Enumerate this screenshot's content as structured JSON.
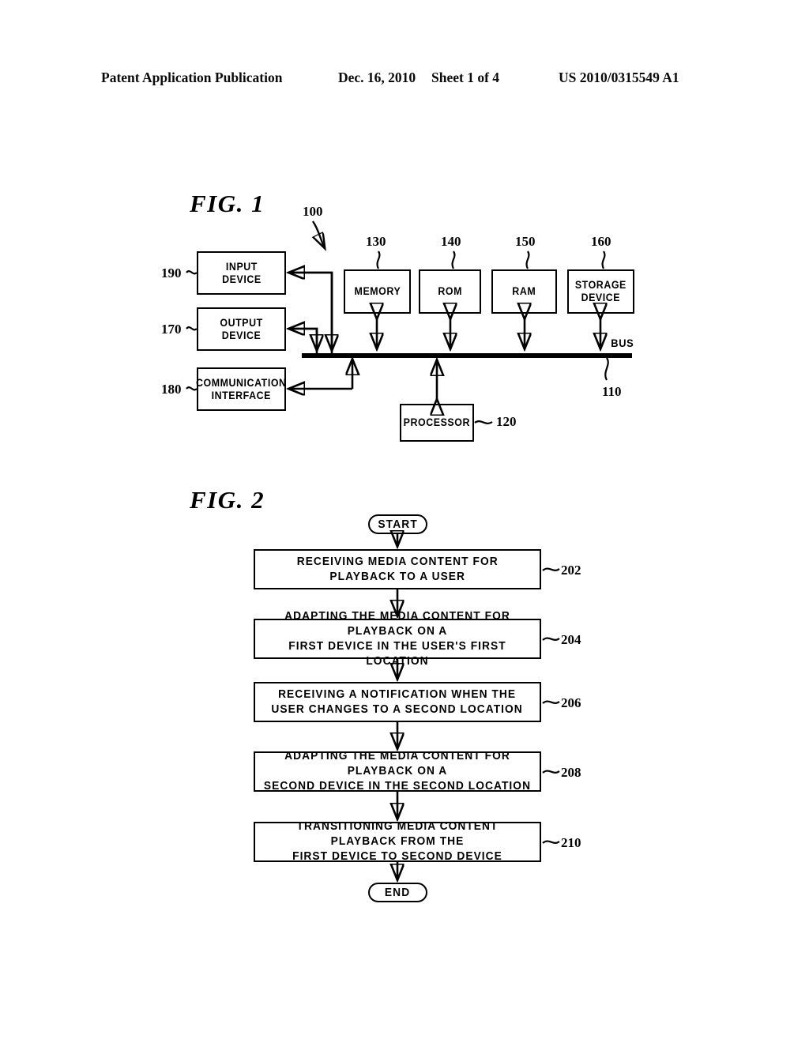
{
  "header": {
    "publication": "Patent Application Publication",
    "date": "Dec. 16, 2010",
    "sheet": "Sheet 1 of 4",
    "patent_number": "US 2010/0315549 A1"
  },
  "figures": [
    {
      "title": "FIG. 1",
      "system_ref": "100",
      "bus_label": "BUS",
      "bus_ref": "110",
      "peripherals": [
        {
          "ref": "190",
          "label": "INPUT\nDEVICE"
        },
        {
          "ref": "170",
          "label": "OUTPUT\nDEVICE"
        },
        {
          "ref": "180",
          "label": "COMMUNICATION\nINTERFACE"
        }
      ],
      "memory_units": [
        {
          "ref": "130",
          "label": "MEMORY"
        },
        {
          "ref": "140",
          "label": "ROM"
        },
        {
          "ref": "150",
          "label": "RAM"
        },
        {
          "ref": "160",
          "label": "STORAGE\nDEVICE"
        }
      ],
      "processor": {
        "ref": "120",
        "label": "PROCESSOR"
      }
    },
    {
      "title": "FIG. 2",
      "start_label": "START",
      "end_label": "END",
      "steps": [
        {
          "ref": "202",
          "label": "RECEIVING MEDIA CONTENT FOR\nPLAYBACK TO A USER"
        },
        {
          "ref": "204",
          "label": "ADAPTING THE MEDIA CONTENT FOR PLAYBACK ON A\nFIRST DEVICE IN THE USER'S FIRST LOCATION"
        },
        {
          "ref": "206",
          "label": "RECEIVING A NOTIFICATION WHEN THE\nUSER CHANGES TO A SECOND LOCATION"
        },
        {
          "ref": "208",
          "label": "ADAPTING THE MEDIA CONTENT FOR PLAYBACK ON A\nSECOND DEVICE IN THE SECOND LOCATION"
        },
        {
          "ref": "210",
          "label": "TRANSITIONING MEDIA CONTENT PLAYBACK FROM THE\nFIRST DEVICE TO SECOND DEVICE"
        }
      ]
    }
  ],
  "colors": {
    "ink": "#000000",
    "paper": "#ffffff"
  }
}
